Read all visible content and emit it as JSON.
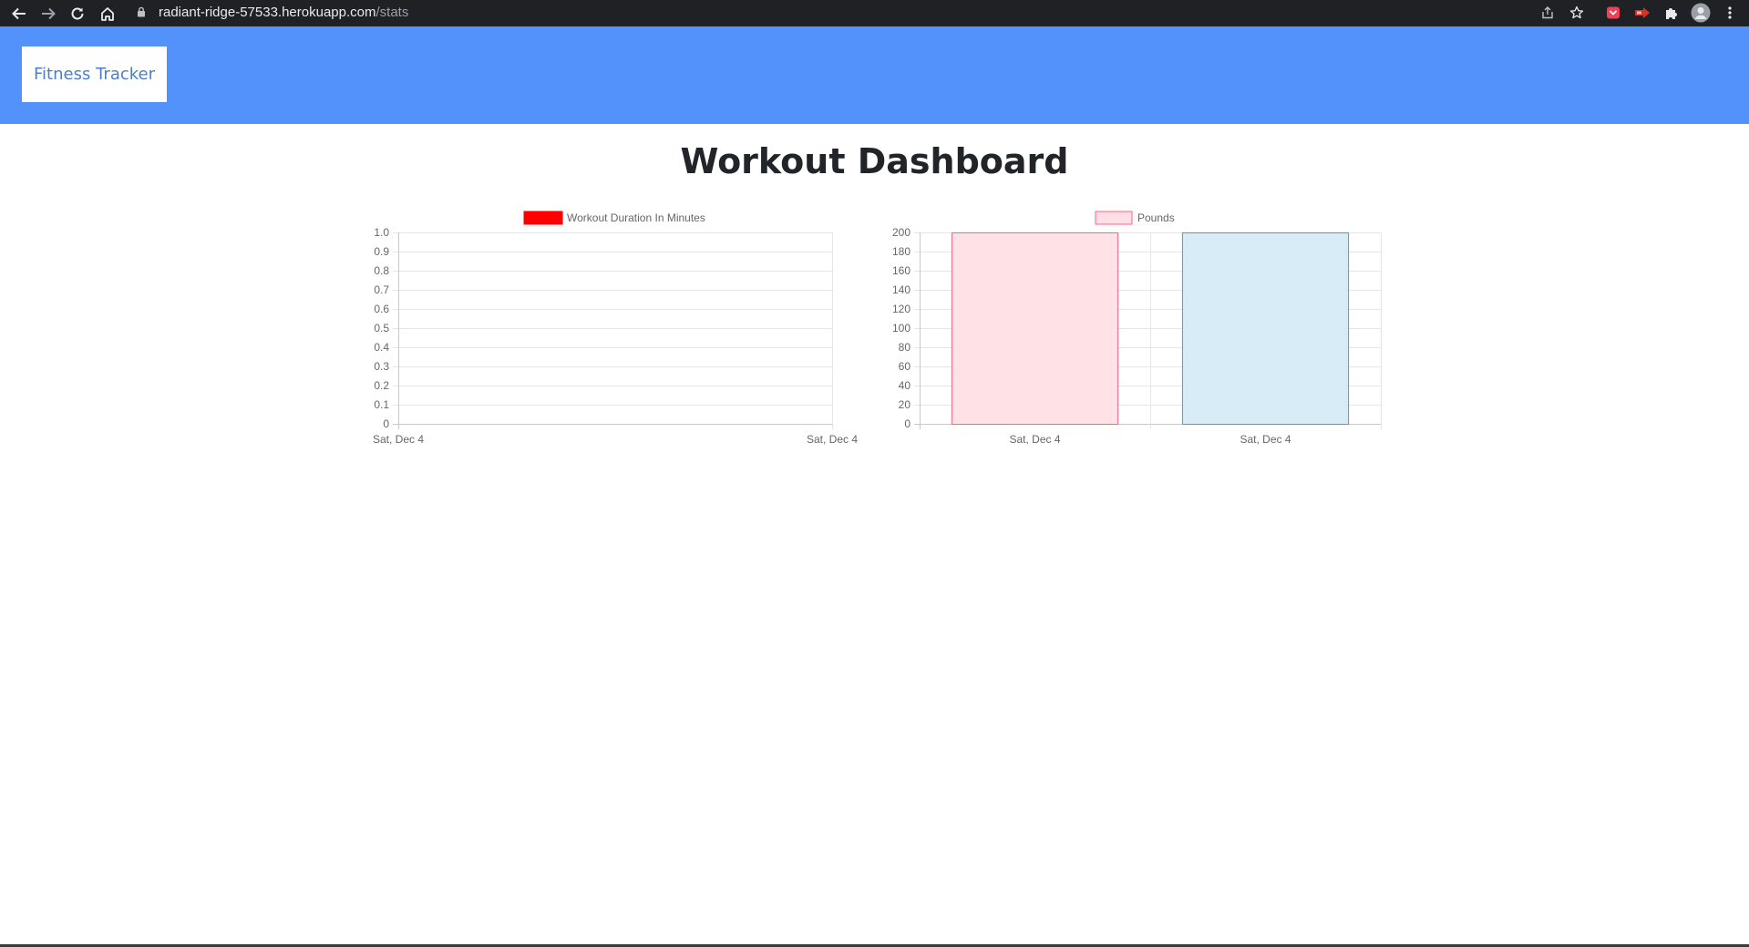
{
  "browser": {
    "url_host": "radiant-ridge-57533.herokuapp.com",
    "url_path": "/stats",
    "icons": [
      "back-arrow-icon",
      "forward-arrow-icon",
      "reload-icon",
      "home-icon",
      "lock-icon",
      "share-icon",
      "star-icon",
      "pocket-icon",
      "extension-arrow-icon",
      "puzzle-icon",
      "profile-avatar-icon",
      "kebab-menu-icon"
    ]
  },
  "navbar": {
    "brand": "Fitness Tracker",
    "color": "#5492fb"
  },
  "page": {
    "title": "Workout Dashboard"
  },
  "chart_data": [
    {
      "type": "line",
      "legend": [
        "Workout Duration In Minutes"
      ],
      "legend_color": "#ff0000",
      "x": [
        "Sat, Dec 4",
        "Sat, Dec 4"
      ],
      "series": [
        {
          "name": "Workout Duration In Minutes",
          "values": []
        }
      ],
      "y_ticks": [
        "1.0",
        "0.9",
        "0.8",
        "0.7",
        "0.6",
        "0.5",
        "0.4",
        "0.3",
        "0.2",
        "0.1",
        "0"
      ],
      "ylim": [
        0,
        1
      ],
      "grid": true,
      "legend_position": "top"
    },
    {
      "type": "bar",
      "legend": [
        "Pounds"
      ],
      "categories": [
        "Sat, Dec 4",
        "Sat, Dec 4"
      ],
      "series": [
        {
          "name": "Pounds",
          "values": [
            200,
            200
          ]
        }
      ],
      "bar_colors": [
        {
          "fill": "#ffdfe5",
          "stroke": "#ff6384"
        },
        {
          "fill": "#d6ebf8",
          "stroke": "#36a2eb"
        }
      ],
      "y_ticks": [
        "200",
        "180",
        "160",
        "140",
        "120",
        "100",
        "80",
        "60",
        "40",
        "20",
        "0"
      ],
      "ylim": [
        0,
        200
      ],
      "grid": true,
      "legend_position": "top"
    }
  ]
}
